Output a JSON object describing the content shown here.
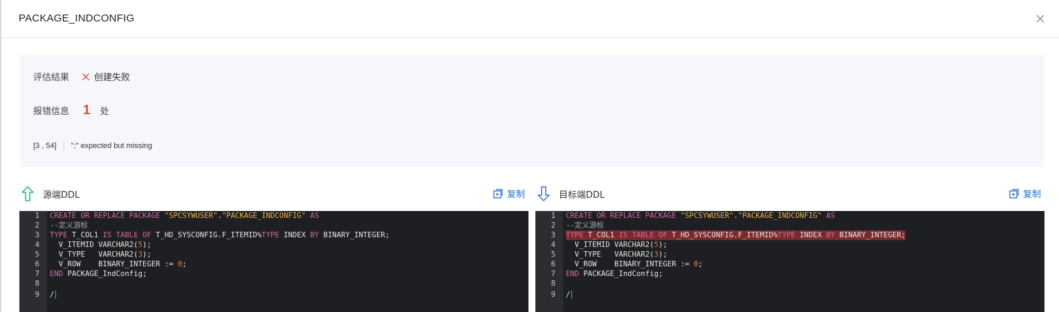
{
  "modal": {
    "title": "PACKAGE_INDCONFIG",
    "close_icon": "close-icon"
  },
  "result": {
    "label": "评估结果",
    "status_icon": "fail-x-icon",
    "status_text": "创建失败",
    "status_color": "#e6453a"
  },
  "errors": {
    "label": "报错信息",
    "count": "1",
    "unit": "处",
    "items": [
      {
        "position": "[3 , 54]",
        "message": "\";\" expected but missing"
      }
    ]
  },
  "source": {
    "label": "源端DDL",
    "arrow_icon": "arrow-up-icon",
    "copy_label": "复制",
    "lines": [
      "CREATE OR REPLACE PACKAGE \"SPCSYWUSER\".\"PACKAGE_INDCONFIG\" AS",
      "--定义游标",
      "TYPE T_COL1 IS TABLE OF T_HD_SYSCONFIG.F_ITEMID%TYPE INDEX BY BINARY_INTEGER;",
      "  V_ITEMID VARCHAR2(5);",
      "  V_TYPE   VARCHAR2(3);",
      "  V_ROW    BINARY_INTEGER := 0;",
      "END PACKAGE_IndConfig;",
      "",
      "/"
    ]
  },
  "target": {
    "label": "目标端DDL",
    "arrow_icon": "arrow-down-icon",
    "copy_label": "复制",
    "error_line": 3,
    "lines": [
      "CREATE OR REPLACE PACKAGE \"SPCSYWUSER\".\"PACKAGE_INDCONFIG\" AS",
      "--定义游标",
      "TYPE T_COL1 IS TABLE OF T_HD_SYSCONFIG.F_ITEMID%TYPE INDEX BY BINARY_INTEGER;",
      "  V_ITEMID VARCHAR2(5);",
      "  V_TYPE   VARCHAR2(3);",
      "  V_ROW    BINARY_INTEGER := 0;",
      "END PACKAGE_IndConfig;",
      "",
      "/"
    ]
  },
  "colors": {
    "accent": "#1f6fd6",
    "arrow_up": "#27b08a",
    "arrow_down": "#3a6fd8",
    "error_highlight": "#7a2a2a"
  }
}
